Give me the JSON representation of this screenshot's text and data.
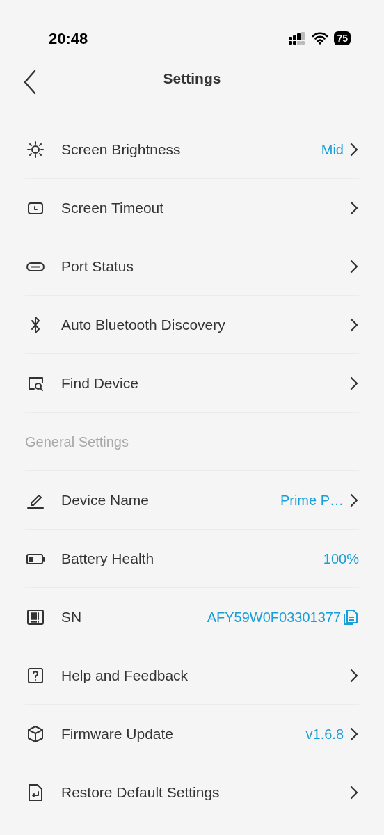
{
  "status_bar": {
    "time": "20:48",
    "battery": "75"
  },
  "header": {
    "title": "Settings"
  },
  "groups": [
    {
      "items": [
        {
          "label": "Screen Brightness",
          "value": "Mid",
          "kind": "link"
        },
        {
          "label": "Screen Timeout",
          "kind": "link"
        },
        {
          "label": "Port Status",
          "kind": "link"
        },
        {
          "label": "Auto Bluetooth Discovery",
          "kind": "link"
        },
        {
          "label": "Find Device",
          "kind": "link"
        }
      ]
    },
    {
      "heading": "General Settings",
      "items": [
        {
          "label": "Device Name",
          "value": "Prime P…",
          "kind": "link"
        },
        {
          "label": "Battery Health",
          "value": "100%",
          "kind": "info"
        },
        {
          "label": "SN",
          "value": "AFY59W0F03301377",
          "kind": "copy"
        },
        {
          "label": "Help and Feedback",
          "kind": "link"
        },
        {
          "label": "Firmware Update",
          "value": "v1.6.8",
          "kind": "link"
        },
        {
          "label": "Restore Default Settings",
          "kind": "link"
        }
      ]
    }
  ]
}
